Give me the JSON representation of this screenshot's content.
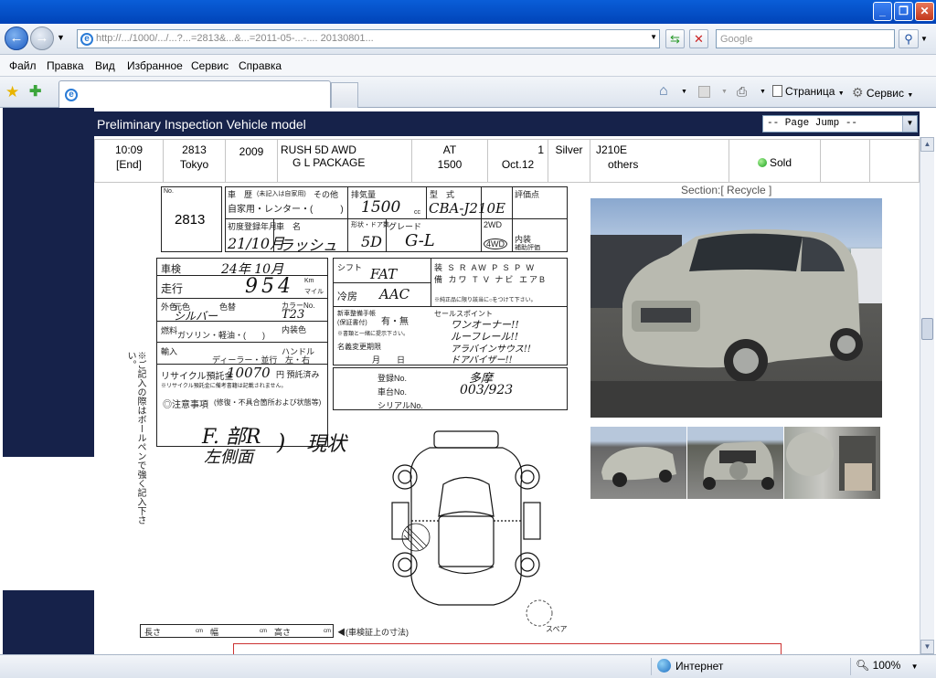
{
  "address": {
    "url": "http://.../1000/.../...?...=2813&...&...=2011-05-...-....                              20130801...",
    "search_placeholder": "Google"
  },
  "menu": [
    "Файл",
    "Правка",
    "Вид",
    "Избранное",
    "Сервис",
    "Справка"
  ],
  "toolbar": {
    "page_label": "Страница",
    "tools_label": "Сервис"
  },
  "page": {
    "header_title": "Preliminary Inspection Vehicle model",
    "page_jump": "-- Page Jump --",
    "row": {
      "time": "10:09",
      "end": "[End]",
      "lot": "2813",
      "place": "Tokyo",
      "year": "2009",
      "model_line1": "RUSH 5D AWD",
      "model_line2": "G L PACKAGE",
      "trans": "AT",
      "cc": "1500",
      "score": "1",
      "date": "Oct.12",
      "color": "Silver",
      "code": "J210E",
      "extra": "others",
      "status": "Sold"
    },
    "section_label": "Section:[ Recycle ]"
  },
  "sheet": {
    "lot_no_label": "No.",
    "lot_no": "2813",
    "car_type_label": "車　歴",
    "car_type_sub": "(未記入は自家用)",
    "car_type_other": "その他",
    "car_type_values": "自家用・レンター・(　　　)",
    "displacement_label": "排気量",
    "displacement": "1500",
    "displacement_unit": "cc",
    "model_label": "型　式",
    "model": "CBA-J210E",
    "score_label": "評価点",
    "first_reg_label": "初度登録年月",
    "first_reg": "21/10月",
    "name_label": "車　名",
    "name": "ラッシュ",
    "doors_label": "形状・ドア数",
    "doors": "5D",
    "grade_label": "グレード",
    "grade": "G-L",
    "drive_label": "2WD",
    "drive": "4WD",
    "interior_label": "内装",
    "interior_sub": "補助評価",
    "inspection_label": "車検",
    "inspection": "24年 10月",
    "mileage_label": "走行",
    "mileage": "954",
    "mileage_unit_km": "Km",
    "mileage_unit_mile": "マイル",
    "shift_label": "シフト",
    "shift": "FAT",
    "aircon_label": "冷房",
    "aircon": "AAC",
    "manual_label": "新車整備手帳",
    "manual_sub": "(保証書付)",
    "manual_value": "有・無",
    "manual_note": "※書類と一緒に提示下さい。",
    "equip_labels": [
      "装",
      "S R",
      "AW",
      "P S",
      "P W"
    ],
    "equip_labels2": [
      "備",
      "カワ",
      "T V",
      "ナビ",
      "エアB"
    ],
    "equip_note": "※純正品に限り該当に○をつけて下さい。",
    "color_label": "外色",
    "color_sub": "元色",
    "color_value": "シルバー",
    "color_no_label": "色替",
    "color_code_label": "カラーNo.",
    "color_code": "T23",
    "fuel_label": "燃料",
    "fuel_values": "ガソリン・軽油・(　　)",
    "interior_color_label": "内装色",
    "import_label": "輸入",
    "import_values": "ディーラー・並行",
    "handle_label": "ハンドル",
    "handle_values": "左・右",
    "sales_label": "セールスポイント",
    "sales_points": [
      "ワンオーナー!!",
      "ルーフレール!!",
      "アラバインサウス!!",
      "ドアバイザー!!"
    ],
    "recycle_label": "リサイクル預託金",
    "recycle_value": "10070",
    "recycle_unit": "円 預託済み",
    "recycle_note": "※リサイクル預託金に備考書籍は記載されません。",
    "name_change_label": "名義変更期限",
    "name_change_values": "月　　日",
    "reg_label": "登録No.",
    "reg_no": "多摩",
    "body_label": "車台No.",
    "body_no": "003/923",
    "serial_label": "シリアルNo.",
    "notes_label": "◎注意事項",
    "notes_sub": "(修復・不具合箇所および状態等)",
    "notes_hand1": "F. 部R",
    "notes_hand2": "左側面",
    "notes_hand3": ")",
    "notes_hand4": "現状",
    "vertical_note": "※ご記入の際はボールペンで強く記入下さい。",
    "dims": [
      "長さ",
      "cm",
      "幅",
      "cm",
      "高さ",
      "cm"
    ],
    "dims_note": "◀(車検証上の寸法)",
    "spare_label": "スペア"
  },
  "status": {
    "zone": "Интернет",
    "zoom": "100%"
  }
}
